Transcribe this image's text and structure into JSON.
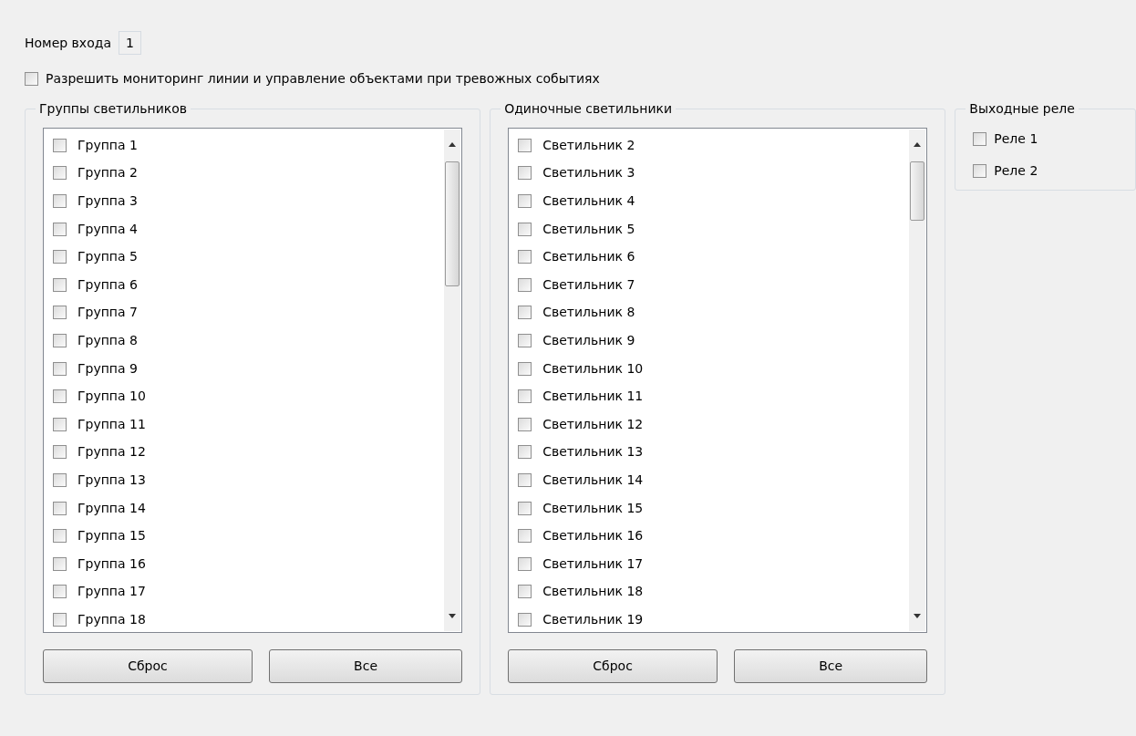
{
  "input_number": {
    "label": "Номер входа",
    "value": "1"
  },
  "enable_monitoring": {
    "label": "Разрешить мониторинг линии и управление объектами при тревожных событиях",
    "checked": false
  },
  "panels": [
    {
      "title": "Группы светильников",
      "items": [
        {
          "label": "Группа 1",
          "checked": false
        },
        {
          "label": "Группа 2",
          "checked": false
        },
        {
          "label": "Группа 3",
          "checked": false
        },
        {
          "label": "Группа 4",
          "checked": false
        },
        {
          "label": "Группа 5",
          "checked": false
        },
        {
          "label": "Группа 6",
          "checked": false
        },
        {
          "label": "Группа 7",
          "checked": false
        },
        {
          "label": "Группа 8",
          "checked": false
        },
        {
          "label": "Группа 9",
          "checked": false
        },
        {
          "label": "Группа 10",
          "checked": false
        },
        {
          "label": "Группа 11",
          "checked": false
        },
        {
          "label": "Группа 12",
          "checked": false
        },
        {
          "label": "Группа 13",
          "checked": false
        },
        {
          "label": "Группа 14",
          "checked": false
        },
        {
          "label": "Группа 15",
          "checked": false
        },
        {
          "label": "Группа 16",
          "checked": false
        },
        {
          "label": "Группа 17",
          "checked": false
        },
        {
          "label": "Группа 18",
          "checked": false
        }
      ],
      "buttons": [
        "Сброс",
        "Все"
      ]
    },
    {
      "title": "Одиночные светильники",
      "items": [
        {
          "label": "Светильник 2",
          "checked": false
        },
        {
          "label": "Светильник 3",
          "checked": false
        },
        {
          "label": "Светильник 4",
          "checked": false
        },
        {
          "label": "Светильник 5",
          "checked": false
        },
        {
          "label": "Светильник 6",
          "checked": false
        },
        {
          "label": "Светильник 7",
          "checked": false
        },
        {
          "label": "Светильник 8",
          "checked": false
        },
        {
          "label": "Светильник 9",
          "checked": false
        },
        {
          "label": "Светильник 10",
          "checked": false
        },
        {
          "label": "Светильник 11",
          "checked": false
        },
        {
          "label": "Светильник 12",
          "checked": false
        },
        {
          "label": "Светильник 13",
          "checked": false
        },
        {
          "label": "Светильник 14",
          "checked": false
        },
        {
          "label": "Светильник 15",
          "checked": false
        },
        {
          "label": "Светильник 16",
          "checked": false
        },
        {
          "label": "Светильник 17",
          "checked": false
        },
        {
          "label": "Светильник 18",
          "checked": false
        },
        {
          "label": "Светильник 19",
          "checked": false
        }
      ],
      "buttons": [
        "Сброс",
        "Все"
      ]
    }
  ],
  "relays": {
    "title": "Выходные реле",
    "items": [
      {
        "label": "Реле 1",
        "checked": false
      },
      {
        "label": "Реле 2",
        "checked": false
      }
    ]
  }
}
